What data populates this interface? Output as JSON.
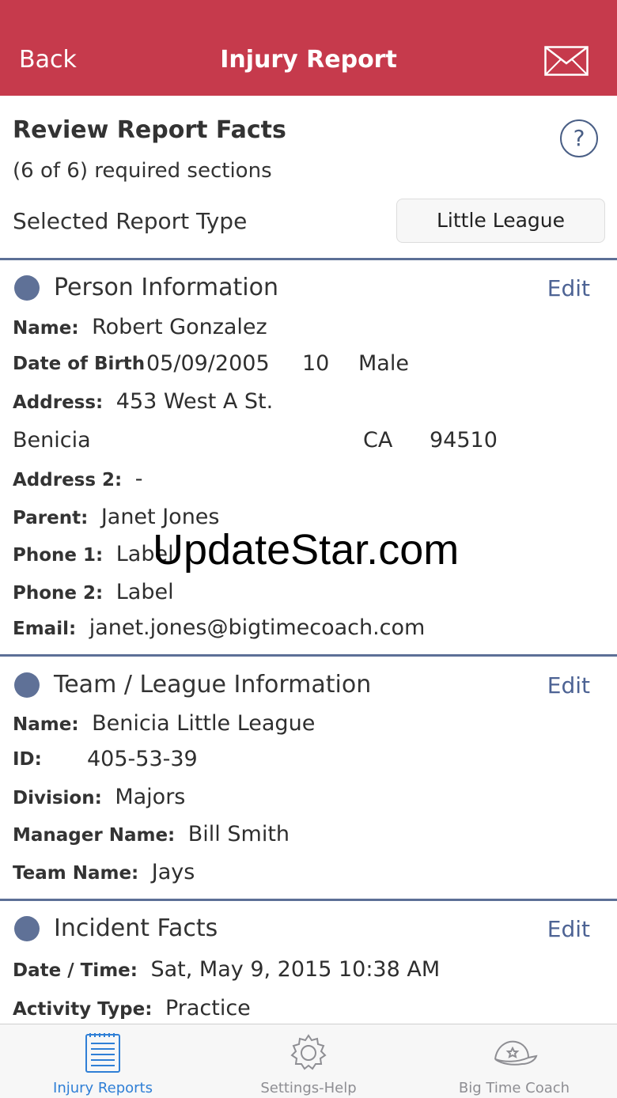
{
  "nav": {
    "back_label": "Back",
    "title": "Injury Report",
    "mail_icon": "envelope-icon"
  },
  "review": {
    "title": "Review Report Facts",
    "subtitle": "(6 of 6) required sections",
    "report_type_label": "Selected Report Type",
    "report_type_value": "Little League",
    "help_symbol": "?"
  },
  "person": {
    "title": "Person Information",
    "edit_label": "Edit",
    "name_label": "Name:",
    "name_value": "Robert Gonzalez",
    "dob_label": "Date of Birth",
    "dob_value": "05/09/2005",
    "age_value": "10",
    "gender_value": "Male",
    "address_label": "Address:",
    "address_value": "453 West A St.",
    "city_value": "Benicia",
    "state_value": "CA",
    "zip_value": "94510",
    "address2_label": "Address 2:",
    "address2_value": "-",
    "parent_label": "Parent:",
    "parent_value": "Janet Jones",
    "phone1_label": "Phone 1:",
    "phone1_value": "Label",
    "phone2_label": "Phone 2:",
    "phone2_value": "Label",
    "email_label": "Email:",
    "email_value": "janet.jones@bigtimecoach.com"
  },
  "team": {
    "title": "Team / League Information",
    "edit_label": "Edit",
    "name_label": "Name:",
    "name_value": "Benicia Little League",
    "id_label": "ID:",
    "id_value": "405-53-39",
    "division_label": "Division:",
    "division_value": "Majors",
    "manager_label": "Manager Name:",
    "manager_value": "Bill Smith",
    "team_label": "Team Name:",
    "team_value": "Jays"
  },
  "incident": {
    "title": "Incident Facts",
    "edit_label": "Edit",
    "datetime_label": "Date / Time:",
    "datetime_value": "Sat, May 9, 2015 10:38 AM",
    "activity_label": "Activity Type:",
    "activity_value": "Practice"
  },
  "watermark": "UpdateStar.com",
  "tabs": [
    {
      "label": "Injury Reports",
      "icon": "notepad-icon",
      "active": true
    },
    {
      "label": "Settings-Help",
      "icon": "gear-icon",
      "active": false
    },
    {
      "label": "Big Time Coach",
      "icon": "baseball-cap-icon",
      "active": false
    }
  ],
  "colors": {
    "header": "#c63a4c",
    "accent": "#4d6394",
    "dot": "#5f7197",
    "tab_active": "#2f7fd6",
    "tab_inactive": "#8e8e93"
  }
}
